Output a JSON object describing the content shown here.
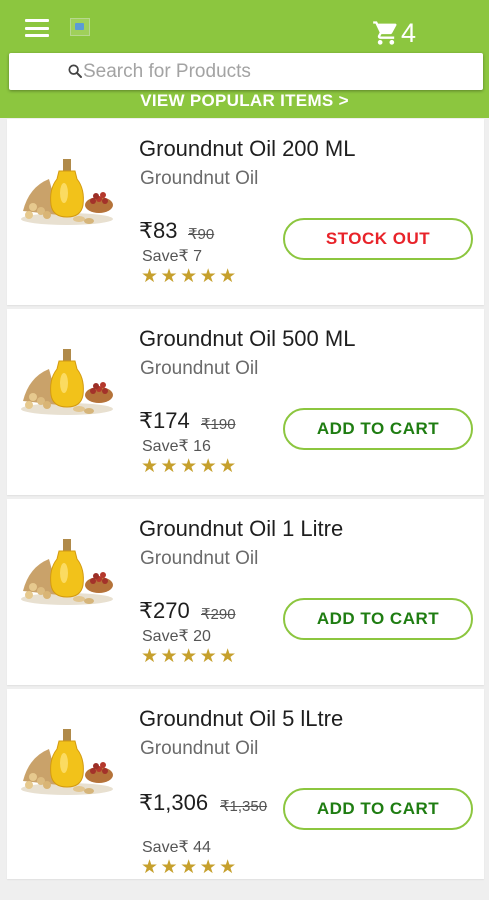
{
  "header": {
    "cart_count": "4",
    "icons": {
      "menu": "hamburger-menu-icon",
      "logo": "broken-image-icon",
      "cart": "shopping-cart-icon",
      "search": "search-icon"
    }
  },
  "search": {
    "placeholder": "Search for Products"
  },
  "popular_link": "VIEW POPULAR ITEMS >",
  "colors": {
    "brand_green": "#8cc63f",
    "stock_out_red": "#e8232a",
    "add_to_cart_green": "#1f7d12",
    "star_gold": "#c6a02d"
  },
  "products": [
    {
      "name": "Groundnut Oil 200 ML",
      "category": "Groundnut Oil",
      "price": "₹83",
      "mrp": "₹90",
      "save": "Save₹ 7",
      "rating_stars": "★★★★★",
      "button": "STOCK OUT"
    },
    {
      "name": "Groundnut Oil 500 ML",
      "category": "Groundnut Oil",
      "price": "₹174",
      "mrp": "₹190",
      "save": "Save₹ 16",
      "rating_stars": "★★★★★",
      "button": "ADD TO CART"
    },
    {
      "name": "Groundnut Oil 1 Litre",
      "category": "Groundnut Oil",
      "price": "₹270",
      "mrp": "₹290",
      "save": "Save₹ 20",
      "rating_stars": "★★★★★",
      "button": "ADD TO CART"
    },
    {
      "name": "Groundnut Oil 5 lLtre",
      "category": "Groundnut Oil",
      "price": "₹1,306",
      "mrp": "₹1,350",
      "save": "Save₹ 44",
      "rating_stars": "★★★★★",
      "button": "ADD TO CART"
    }
  ]
}
